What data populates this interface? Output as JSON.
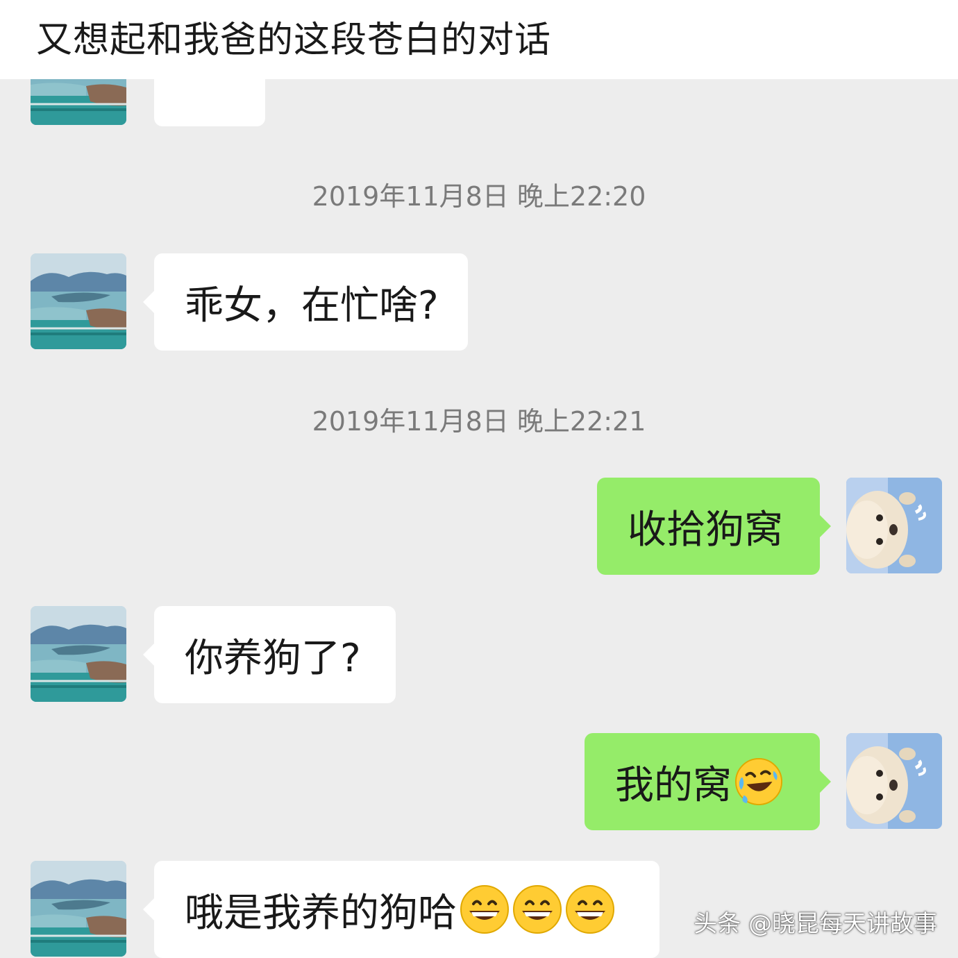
{
  "post": {
    "caption": "又想起和我爸的这段苍白的对话"
  },
  "chat": {
    "timestamps": [
      "2019年11月8日 晚上22:20",
      "2019年11月8日 晚上22:21"
    ],
    "messages": [
      {
        "sender": "dad",
        "text": ""
      },
      {
        "sender": "dad",
        "text": "乖女，在忙啥?"
      },
      {
        "sender": "me",
        "text": "收拾狗窝"
      },
      {
        "sender": "dad",
        "text": "你养狗了?"
      },
      {
        "sender": "me",
        "text": "我的窝",
        "emoji": [
          "rolling-laughing-emoji"
        ]
      },
      {
        "sender": "dad",
        "text": "哦是我养的狗哈",
        "emoji": [
          "grinning-emoji",
          "grinning-emoji",
          "grinning-emoji"
        ]
      }
    ]
  },
  "watermark": {
    "text": "头条 @晓昆每天讲故事"
  },
  "colors": {
    "background": "#ededed",
    "incoming_bubble": "#ffffff",
    "outgoing_bubble": "#95ec69",
    "timestamp_text": "#7a7a7a"
  }
}
